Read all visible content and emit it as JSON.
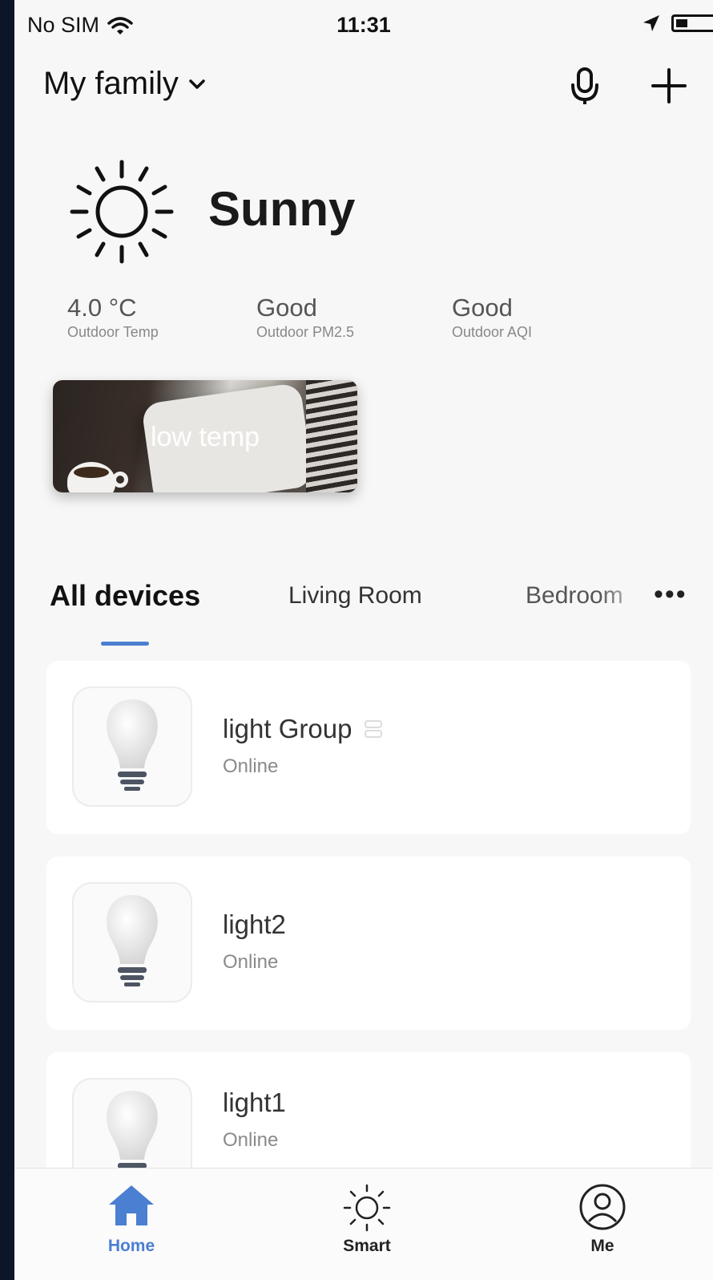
{
  "status_bar": {
    "carrier": "No SIM",
    "time": "11:31"
  },
  "header": {
    "family_label": "My family"
  },
  "weather": {
    "condition": "Sunny",
    "stats": [
      {
        "value": "4.0 °C",
        "label": "Outdoor Temp"
      },
      {
        "value": "Good",
        "label": "Outdoor PM2.5"
      },
      {
        "value": "Good",
        "label": "Outdoor AQI"
      }
    ]
  },
  "scene": {
    "label": "low temp"
  },
  "tabs": [
    {
      "label": "All devices",
      "active": true
    },
    {
      "label": "Living Room",
      "active": false
    },
    {
      "label": "Bedroom",
      "active": false
    }
  ],
  "more_label": "•••",
  "devices": [
    {
      "name": "light Group",
      "status": "Online",
      "is_group": true
    },
    {
      "name": "light2",
      "status": "Online",
      "is_group": false
    },
    {
      "name": "light1",
      "status": "Online",
      "is_group": false
    }
  ],
  "bottom_nav": [
    {
      "label": "Home",
      "active": true
    },
    {
      "label": "Smart",
      "active": false
    },
    {
      "label": "Me",
      "active": false
    }
  ],
  "colors": {
    "accent": "#4a7fd1",
    "background": "#f7f7f7",
    "card": "#ffffff"
  }
}
